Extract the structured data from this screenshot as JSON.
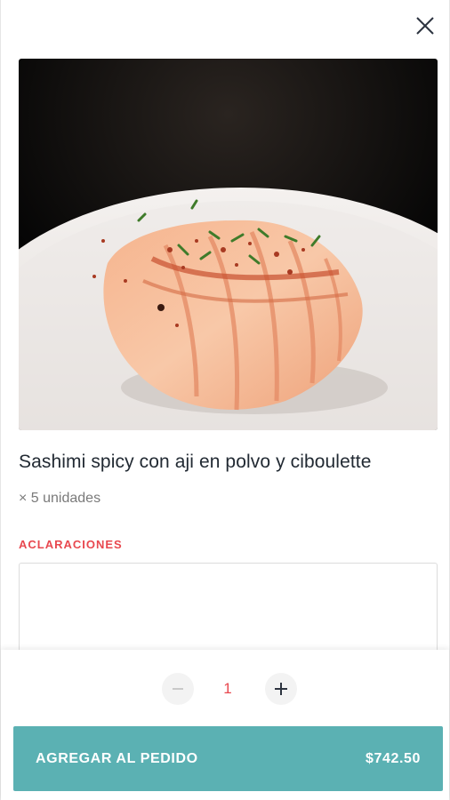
{
  "product": {
    "name": "Sashimi spicy con aji en polvo y ciboulette",
    "units": "× 5 unidades"
  },
  "notes": {
    "label": "ACLARACIONES",
    "value": ""
  },
  "quantity": {
    "value": "1"
  },
  "add_button": {
    "label": "AGREGAR AL PEDIDO",
    "price": "$742.50"
  },
  "colors": {
    "accent": "#e8484f",
    "button": "#5bb1b3",
    "title": "#222a33"
  },
  "icons": {
    "close": "close-icon",
    "minus": "minus-icon",
    "plus": "plus-icon"
  }
}
